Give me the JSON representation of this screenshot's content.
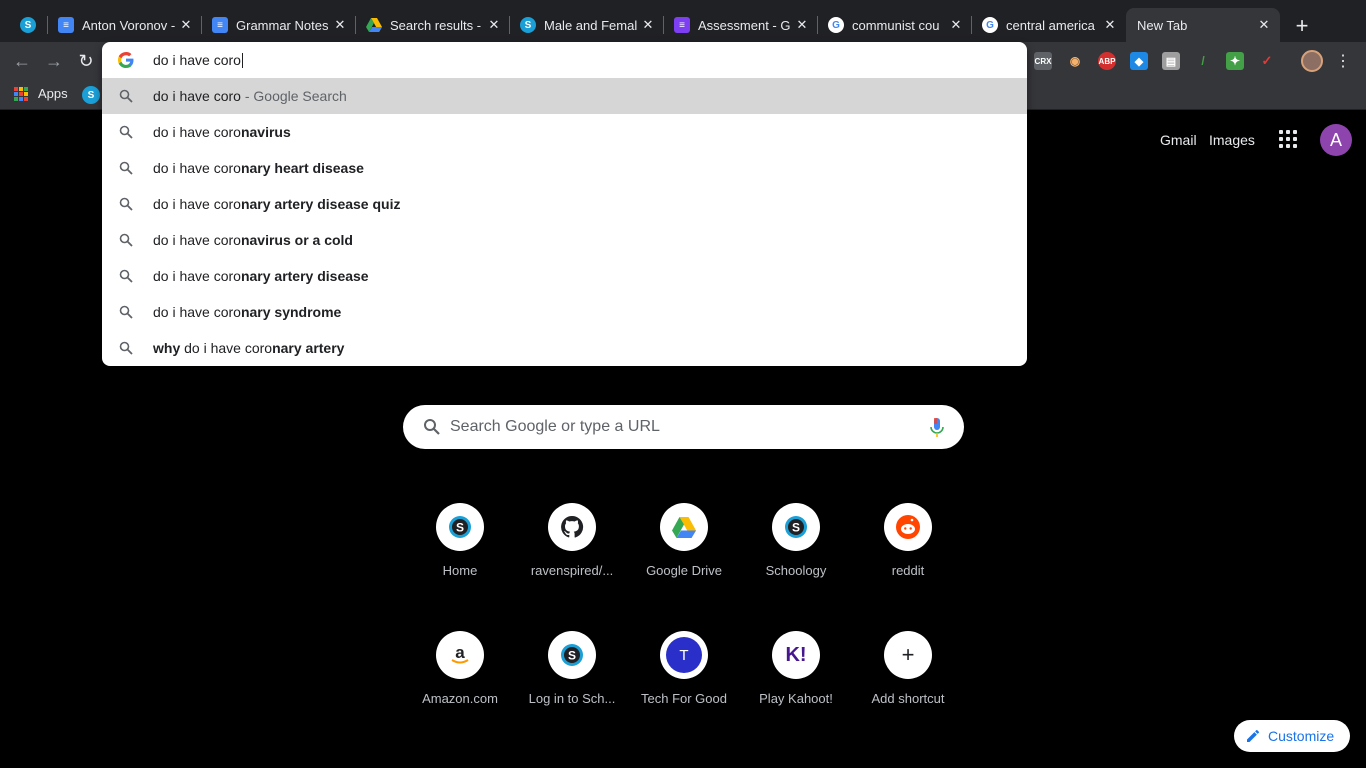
{
  "tabs": [
    {
      "title": "",
      "icon": "schoology-icon",
      "favicon_bg": "#1a9fd6",
      "favicon_text": "S"
    },
    {
      "title": "Anton Voronov -",
      "icon": "google-docs-icon",
      "favicon_bg": "#4285f4",
      "favicon_text": "≡"
    },
    {
      "title": "Grammar Notes",
      "icon": "google-docs-icon",
      "favicon_bg": "#4285f4",
      "favicon_text": "≡"
    },
    {
      "title": "Search results -",
      "icon": "google-drive-icon",
      "favicon_bg": "#202124",
      "favicon_text": "▲"
    },
    {
      "title": "Male and Femal",
      "icon": "schoology-icon",
      "favicon_bg": "#1a9fd6",
      "favicon_text": "S"
    },
    {
      "title": "Assessment - G",
      "icon": "google-forms-icon",
      "favicon_bg": "#7e3ff2",
      "favicon_text": "≡"
    },
    {
      "title": "communist cou",
      "icon": "google-icon",
      "favicon_bg": "#ffffff",
      "favicon_text": "G"
    },
    {
      "title": "central america",
      "icon": "google-icon",
      "favicon_bg": "#ffffff",
      "favicon_text": "G"
    },
    {
      "title": "New Tab",
      "icon": "",
      "favicon_bg": "",
      "favicon_text": ""
    }
  ],
  "bookmarks": {
    "apps_label": "Apps"
  },
  "omnibox": {
    "typed": "do i have coro",
    "suggestions": [
      {
        "pre": "do i have coro",
        "bold": "",
        "suffix": " - Google Search"
      },
      {
        "pre": "do i have coro",
        "bold": "navirus",
        "suffix": ""
      },
      {
        "pre": "do i have coro",
        "bold": "nary heart disease",
        "suffix": ""
      },
      {
        "pre": "do i have coro",
        "bold": "nary artery disease quiz",
        "suffix": ""
      },
      {
        "pre": "do i have coro",
        "bold": "navirus or a cold",
        "suffix": ""
      },
      {
        "pre": "do i have coro",
        "bold": "nary artery disease",
        "suffix": ""
      },
      {
        "pre": "do i have coro",
        "bold": "nary syndrome",
        "suffix": ""
      },
      {
        "leadbold": "why",
        "pre": " do i have coro",
        "bold": "nary artery",
        "suffix": ""
      }
    ]
  },
  "header": {
    "gmail": "Gmail",
    "images": "Images",
    "account_initial": "A"
  },
  "search": {
    "placeholder": "Search Google or type a URL"
  },
  "shortcuts": [
    {
      "label": "Home",
      "icon": "schoology-icon"
    },
    {
      "label": "ravenspired/...",
      "icon": "github-icon"
    },
    {
      "label": "Google Drive",
      "icon": "google-drive-icon"
    },
    {
      "label": "Schoology",
      "icon": "schoology-icon"
    },
    {
      "label": "reddit",
      "icon": "reddit-icon"
    },
    {
      "label": "Amazon.com",
      "icon": "amazon-icon"
    },
    {
      "label": "Log in to Sch...",
      "icon": "schoology-icon"
    },
    {
      "label": "Tech For Good",
      "icon": "letter-t-icon",
      "letter": "T"
    },
    {
      "label": "Play Kahoot!",
      "icon": "kahoot-icon",
      "letter": "K!"
    },
    {
      "label": "Add shortcut",
      "icon": "plus-icon"
    }
  ],
  "customize": {
    "label": "Customize"
  },
  "extensions": [
    {
      "name": "crx-icon",
      "text": "CRX",
      "bg": "#5f6368"
    },
    {
      "name": "owl-icon",
      "text": "◉",
      "bg": "#35363a"
    },
    {
      "name": "adblock-plus-icon",
      "text": "ABP",
      "bg": "#d32f2f"
    },
    {
      "name": "dropbox-like-icon",
      "text": "◆",
      "bg": "#1e88e5"
    },
    {
      "name": "briefcase-icon",
      "text": "▤",
      "bg": "#9e9e9e"
    },
    {
      "name": "pen-icon",
      "text": "/",
      "bg": "#35363a"
    },
    {
      "name": "colorful-icon",
      "text": "✦",
      "bg": "#43a047"
    },
    {
      "name": "kite-icon",
      "text": "✓",
      "bg": "#35363a"
    }
  ]
}
